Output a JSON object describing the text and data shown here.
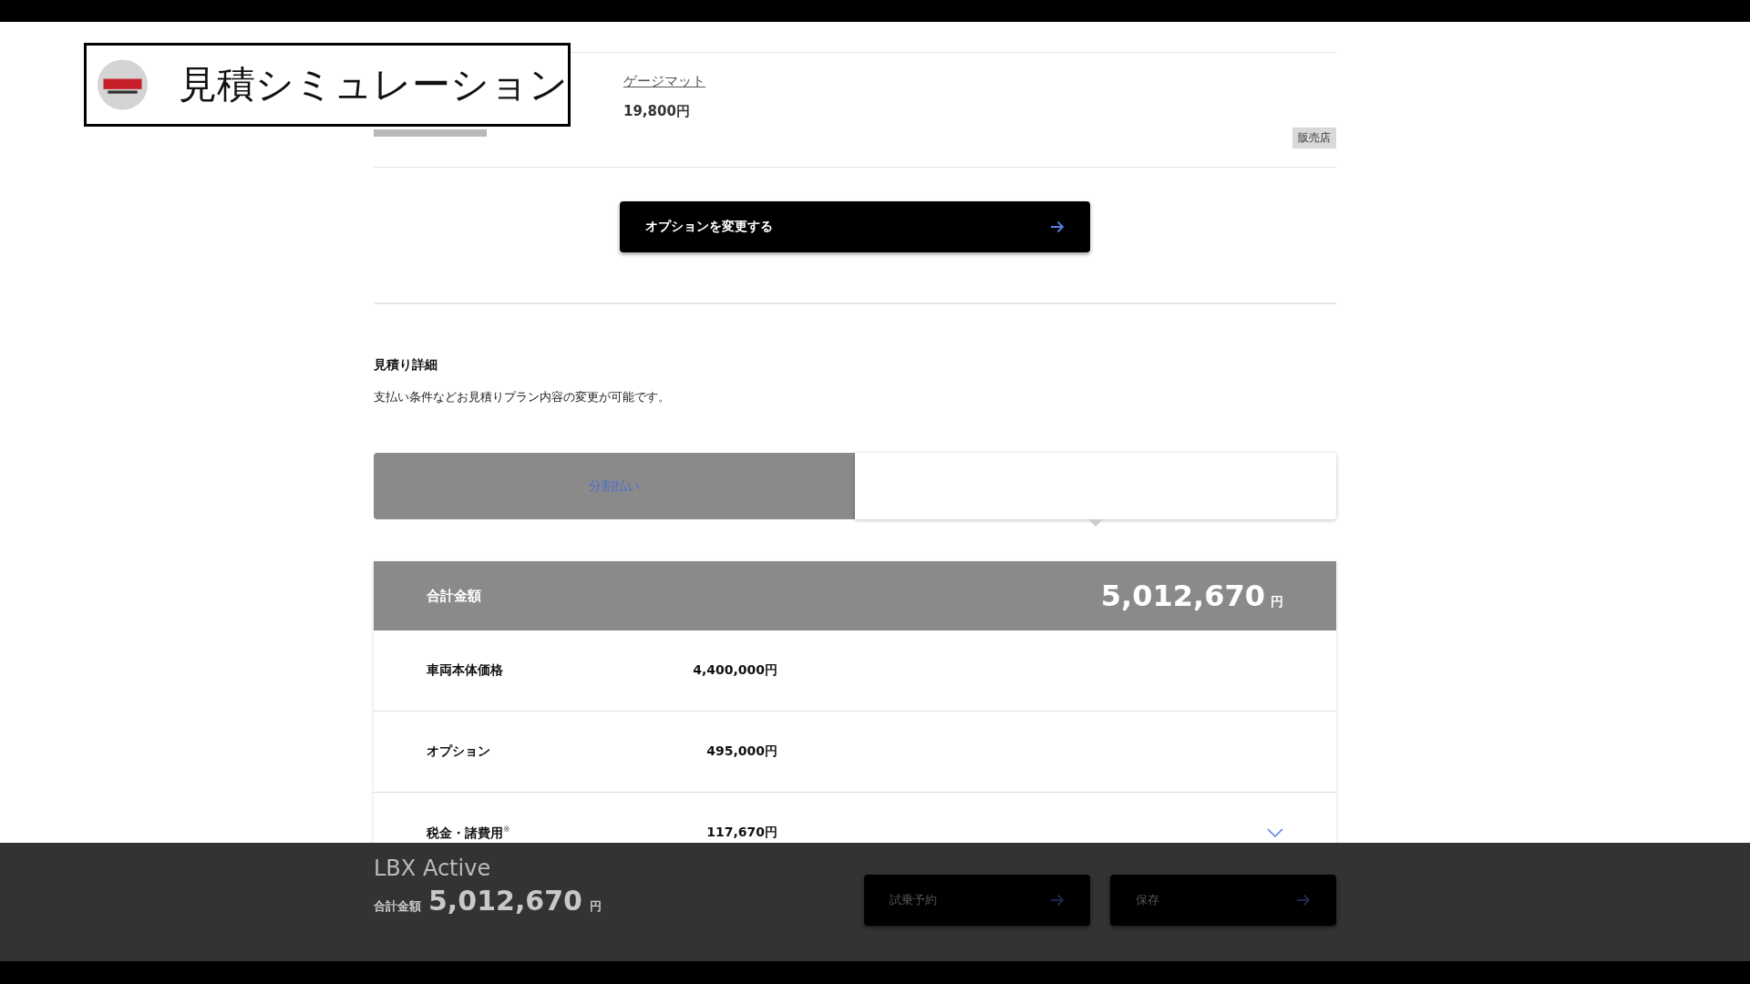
{
  "overlay": {
    "title": "見積シミュレーション"
  },
  "option_item": {
    "name": "ゲージマット",
    "price": "19,800円",
    "badge": "販売店"
  },
  "change_options_button": "オプションを変更する",
  "estimate_details": {
    "heading": "見積り詳細",
    "description": "支払い条件などお見積りプラン内容の変更が可能です。"
  },
  "tabs": [
    {
      "label": "分割払い",
      "selected": false
    },
    {
      "selected": true
    }
  ],
  "summary": {
    "total_label": "合計金額",
    "total_value": "5,012,670",
    "total_unit": "円",
    "rows": [
      {
        "label": "車両本体価格",
        "value": "4,400,000円",
        "expandable": false
      },
      {
        "label": "オプション",
        "value": "495,000円",
        "expandable": false
      },
      {
        "label": "税金・諸費用$^{※}$",
        "value": "117,670円",
        "expandable": true
      }
    ]
  },
  "bottom_bar": {
    "model": "LBX Active",
    "total_label": "合計金額",
    "total_value": "5,012,670",
    "total_unit": "円",
    "buttons": [
      "試乗予約",
      "保存"
    ]
  }
}
